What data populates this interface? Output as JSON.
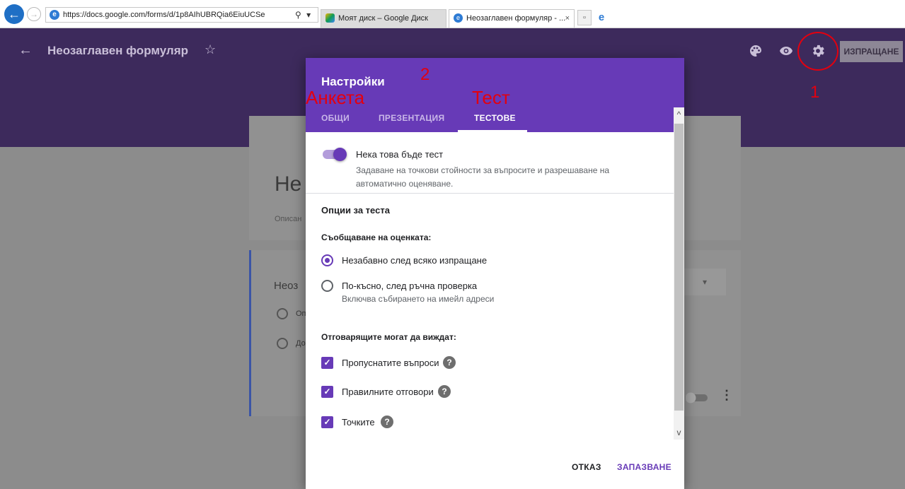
{
  "browser": {
    "url": "https://docs.google.com/forms/d/1p8AIhUBRQia6EiuUCSe",
    "tabs": [
      {
        "label": "Моят диск – Google Диск"
      },
      {
        "label": "Неозаглавен формуляр - ...",
        "close": "×"
      }
    ]
  },
  "header": {
    "title": "Неозаглавен формуляр",
    "send_label": "ИЗПРАЩАНЕ"
  },
  "annotations": {
    "num1": "1",
    "num2": "2",
    "survey": "Анкета",
    "test": "Тест"
  },
  "background": {
    "title_fragment": "Не",
    "desc_fragment": "Описан",
    "question_fragment": "Неоз",
    "option1_fragment": "Оп",
    "option2_fragment": "До"
  },
  "dialog": {
    "title": "Настройки",
    "tabs": [
      "ОБЩИ",
      "ПРЕЗЕНТАЦИЯ",
      "ТЕСТОВЕ"
    ],
    "active_tab": "ТЕСТОВЕ",
    "quiz_toggle": {
      "label": "Нека това бъде тест",
      "description": "Задаване на точкови стойности за въпросите и разрешаване на автоматично оценяване.",
      "on": true
    },
    "quiz_options_title": "Опции за теста",
    "release_grade": {
      "title": "Съобщаване на оценката:",
      "options": [
        {
          "label": "Незабавно след всяко изпращане",
          "checked": true
        },
        {
          "label": "По-късно, след ръчна проверка",
          "description": "Включва събирането на имейл адреси",
          "checked": false
        }
      ]
    },
    "respondents_can_see": {
      "title": "Отговарящите могат да виждат:",
      "options": [
        {
          "label": "Пропуснатите въпроси",
          "checked": true
        },
        {
          "label": "Правилните отговори",
          "checked": true
        },
        {
          "label": "Точките",
          "checked": true
        }
      ]
    },
    "cancel_label": "ОТКАЗ",
    "save_label": "ЗАПАЗВАНЕ"
  },
  "colors": {
    "accent": "#673ab7",
    "header_bg": "#3d2a5c",
    "annotation": "#e3000f"
  }
}
